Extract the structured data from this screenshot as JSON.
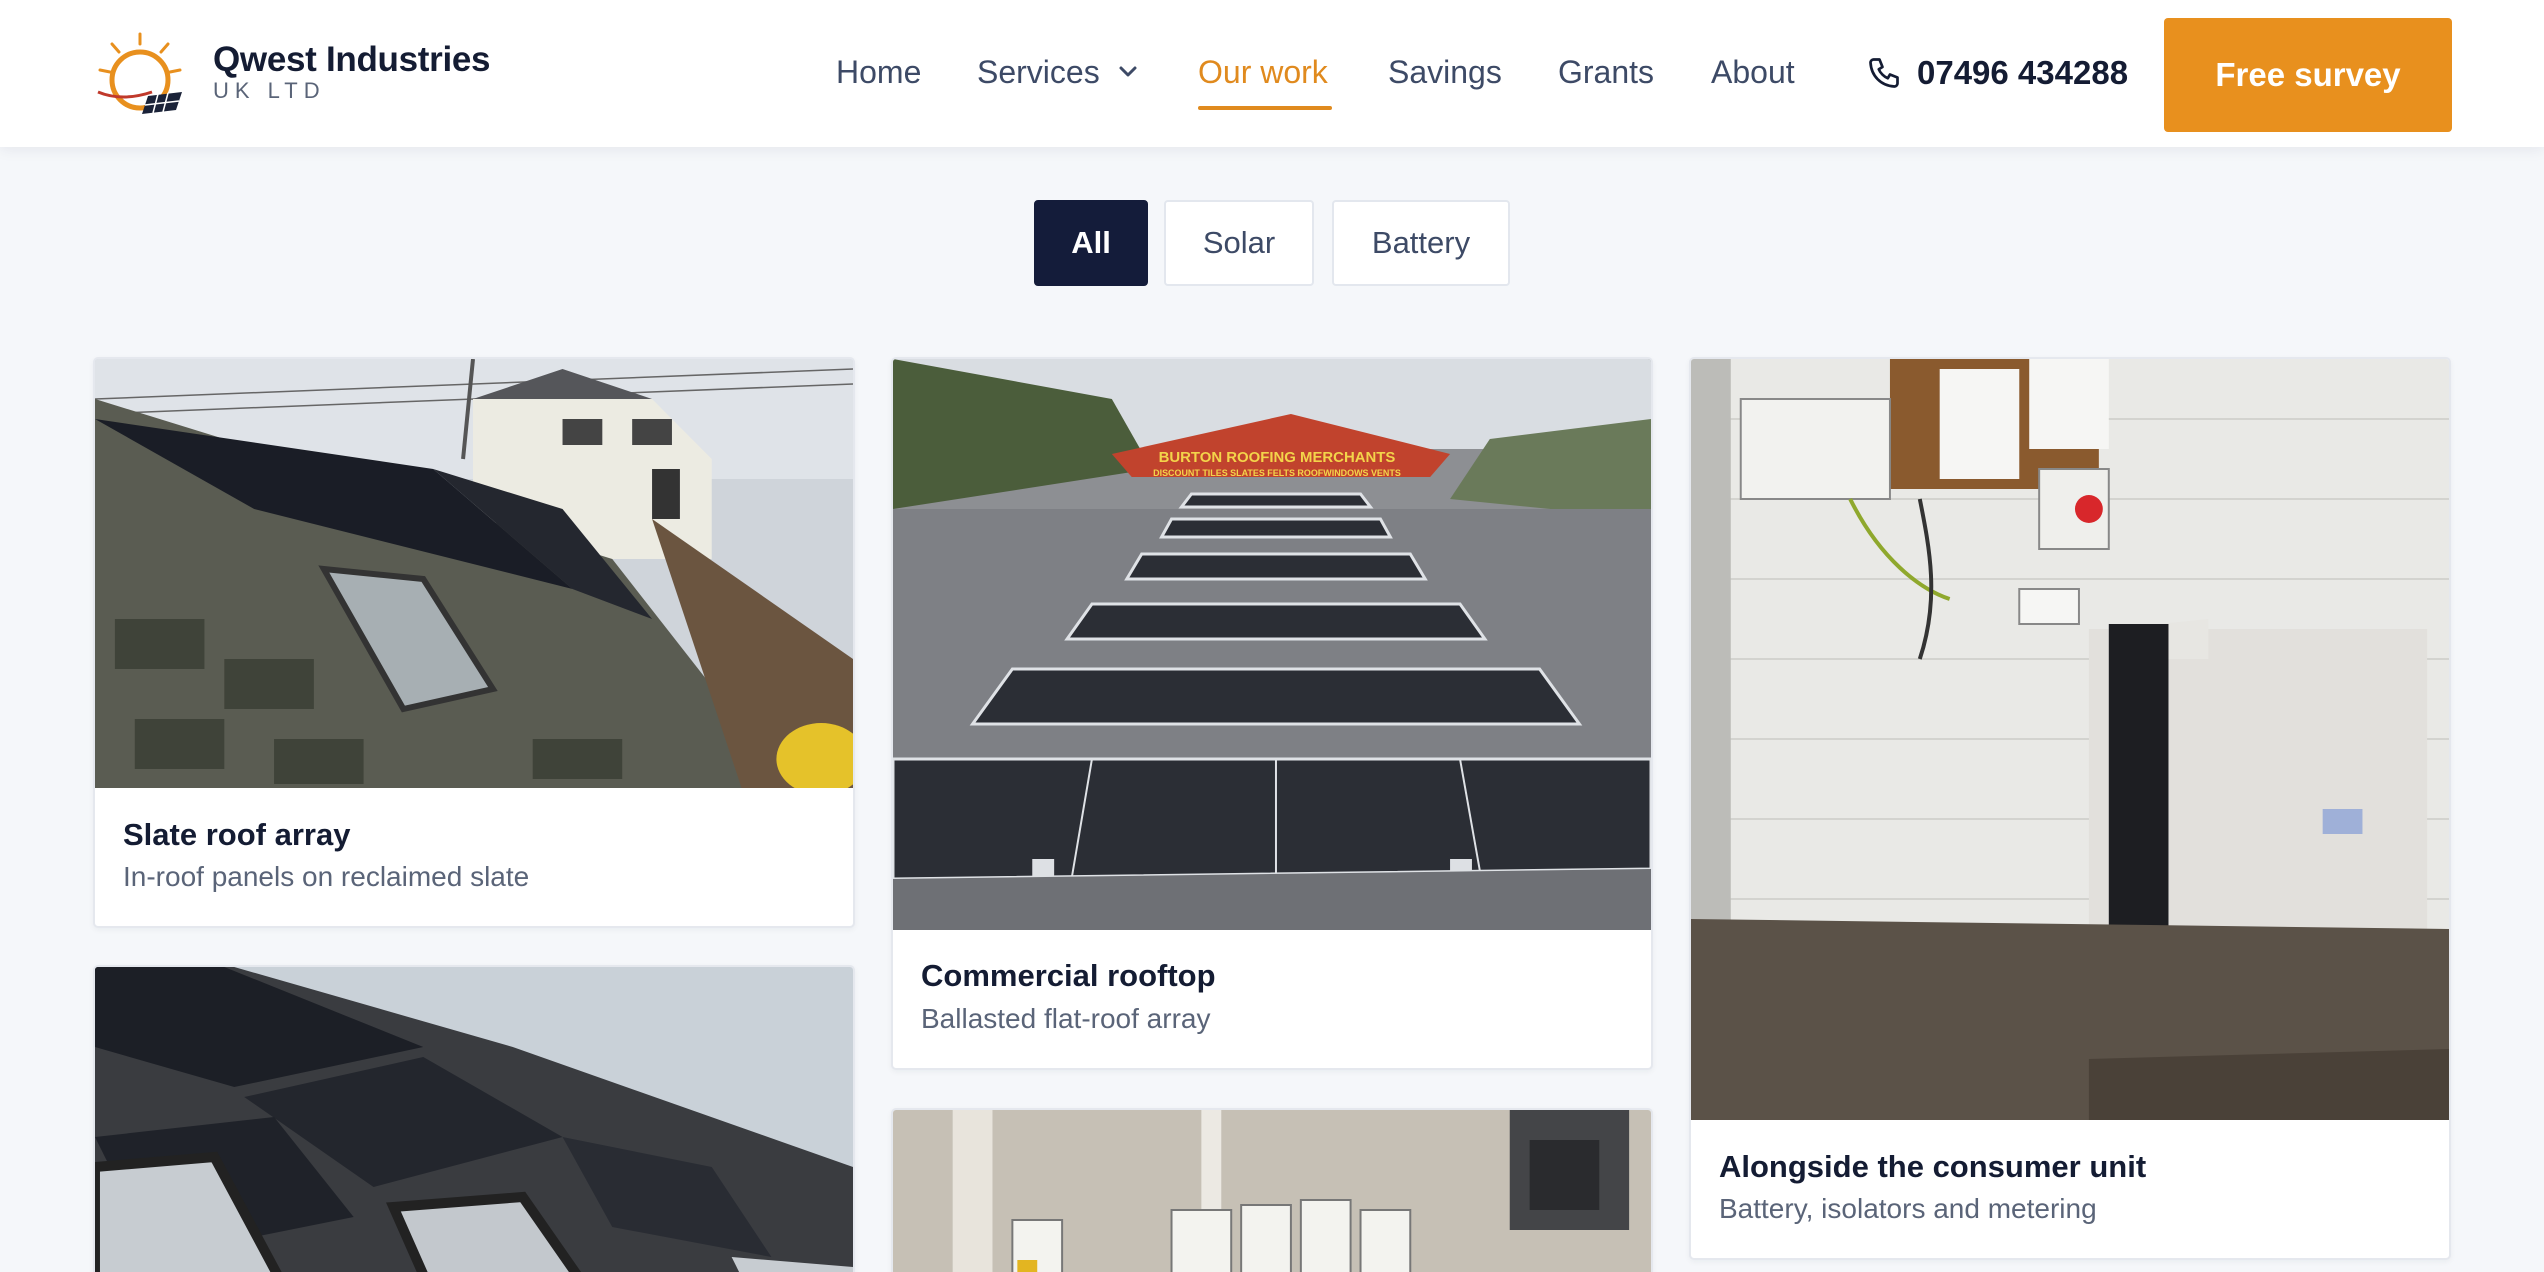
{
  "brand": {
    "name": "Qwest Industries",
    "sub": "UK LTD"
  },
  "nav": {
    "home": "Home",
    "services": "Services",
    "our_work": "Our work",
    "savings": "Savings",
    "grants": "Grants",
    "about": "About"
  },
  "phone": "07496 434288",
  "cta": "Free survey",
  "filters": {
    "all": "All",
    "solar": "Solar",
    "battery": "Battery",
    "active": "All"
  },
  "projects": [
    {
      "title": "Slate roof array",
      "subtitle": "In-roof panels on reclaimed slate"
    },
    {
      "title": "Commercial rooftop",
      "subtitle": "Ballasted flat-roof array"
    },
    {
      "title": "Alongside the consumer unit",
      "subtitle": "Battery, isolators and metering"
    }
  ],
  "photo_text": {
    "sign_line1": "BURTON ROOFING MERCHANTS",
    "sign_line2": "DISCOUNT TILES SLATES FELTS ROOFWINDOWS VENTS"
  },
  "colors": {
    "accent": "#e8901e",
    "active_filter": "#141c3a",
    "text": "#141c33"
  },
  "icons": {
    "logo": "sun-solar-logo",
    "dropdown": "chevron-down-icon",
    "phone": "phone-icon"
  }
}
